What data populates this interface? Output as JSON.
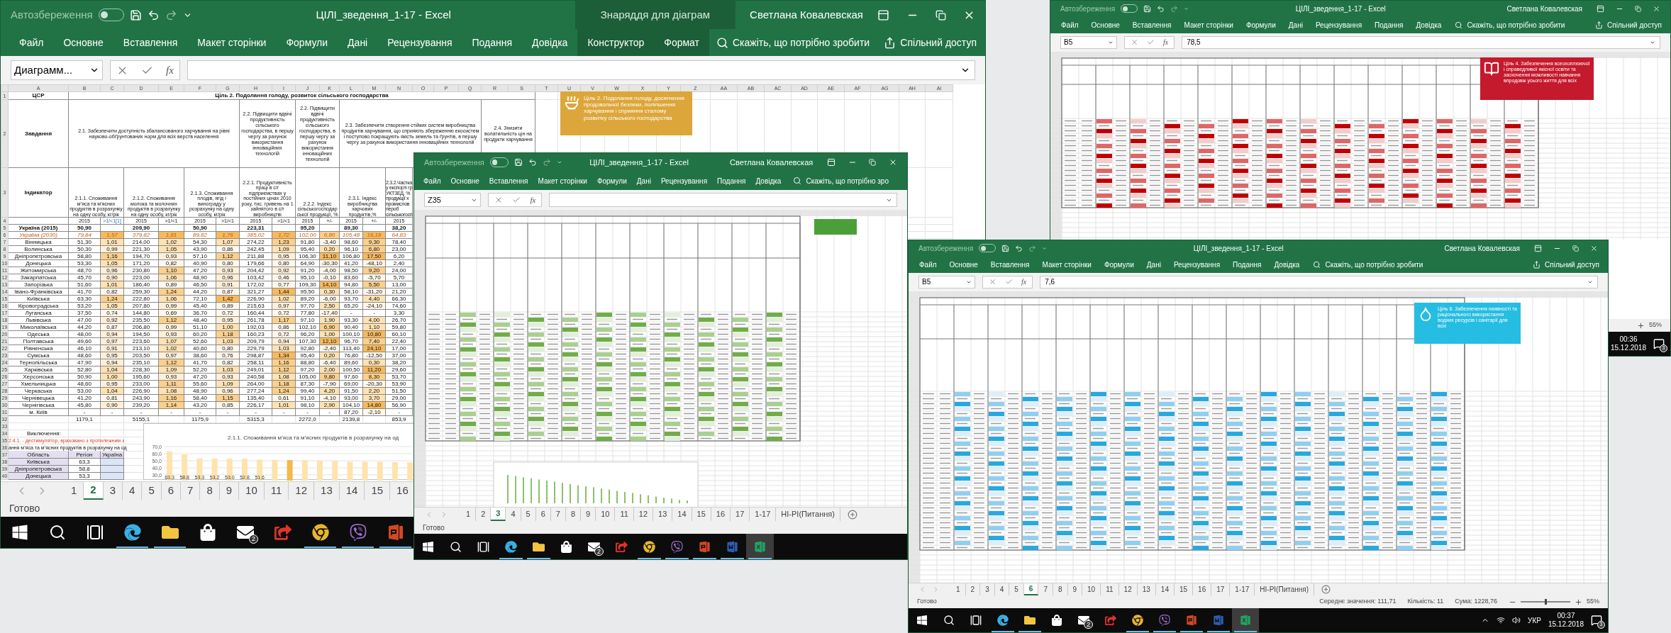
{
  "main_window": {
    "title": "ЦІЛІ_зведення_1-17 - Excel",
    "autosave": {
      "label": "Автозбереження",
      "on": false
    },
    "chart_tools": "Знаряддя для діаграм",
    "user": "Светлана Ковалевская",
    "menu": [
      {
        "label": "Файл",
        "contextual": false
      },
      {
        "label": "Основне",
        "contextual": false
      },
      {
        "label": "Вставлення",
        "contextual": false
      },
      {
        "label": "Макет сторінки",
        "contextual": false
      },
      {
        "label": "Формули",
        "contextual": false
      },
      {
        "label": "Дані",
        "contextual": false
      },
      {
        "label": "Рецензування",
        "contextual": false
      },
      {
        "label": "Подання",
        "contextual": false
      },
      {
        "label": "Довідка",
        "contextual": false
      },
      {
        "label": "Конструктор",
        "contextual": true
      },
      {
        "label": "Формат",
        "contextual": true
      }
    ],
    "search": "Скажіть, що потрібно зробити",
    "share": "Спільний доступ",
    "name_box": "Диаграмм...",
    "function_label": "fx",
    "sheet": {
      "column_headers": [
        "A",
        "B",
        "C",
        "D",
        "E",
        "F",
        "G",
        "H",
        "I",
        "J",
        "K",
        "L",
        "M",
        "N",
        "O",
        "P",
        "Q",
        "R",
        "S",
        "T",
        "U",
        "V",
        "W",
        "X",
        "Y",
        "Z",
        "AA",
        "AB",
        "AC",
        "AD",
        "AE",
        "AF",
        "AG",
        "AH",
        "AI"
      ],
      "row_numbers": [
        "1",
        "2",
        "3",
        "4",
        "5",
        "6",
        "7",
        "8",
        "9",
        "10",
        "11",
        "12",
        "13",
        "14",
        "15",
        "16",
        "17",
        "18",
        "19",
        "20",
        "21",
        "22",
        "23",
        "24",
        "25",
        "26",
        "27",
        "28",
        "29",
        "30",
        "31",
        "32",
        "33",
        "34",
        "35",
        "36",
        "37",
        "38",
        "39",
        "40"
      ],
      "goal_row": {
        "label": "ЦСР",
        "title": "Ціль 2. Подолання голоду, розвиток сільського господарства"
      },
      "tasks": {
        "label": "Завдання",
        "items": [
          "2.1. Забезпечити доступність збалансованого харчування на рівні науково-обґрунтованих норм для всіх верств населення",
          "2.2. Підвищити вдвічі продуктивність сільського господарства, в першу чергу за рахунок використання інноваційних технологій",
          "2.2. Підвищити вдвічі продуктивність сільського господарства, в першу чергу за рахунок використання інноваційних технологій",
          "2.3. Забезпечити створення стійких систем виробництва продуктів харчування, що сприяють збереженню екосистем і поступово покращують якість земель та ґрунтів, в першу чергу за рахунок використання інноваційних технологій",
          "2.4. Знизити волатильність цін на продукти харчування"
        ]
      },
      "indicators": {
        "label": "Індикатор",
        "items": [
          "2.1.1. Споживання м’яса та м’ясних продуктів в розрахунку на одну особу, кг/рік",
          "2.1.2. Споживання молока та молочних продуктів в розрахунку на одну особу, кг/рік",
          "2.1.3. Споживання плодів, ягід і винограду у розрахунку на одну особу, кг/рік",
          "2.2.1. Продуктивність праці в с/г підприємствах у постійних цінах 2010 року, тис. гривень на 1 зайнятого в с/г виробництві",
          "2.2.2. Індекс сільськогосподарської продукції, %",
          "2.3.1. Індекс виробництва харчових продуктів,%",
          "2.3.2.Частка\nу експорті гр\nУКТЗЕД, %\nпродукції х\nпромислов\nпероб\nсільськогосп"
        ]
      },
      "periods": [
        "2015",
        ">1/<1[1]",
        "2015",
        ">1/<1",
        "2015",
        ">1/<1",
        "2015",
        ">1/<1",
        "2015",
        "+/-",
        "2015",
        "+/-",
        "2015"
      ],
      "rows": [
        {
          "kind": "total",
          "region": "Україна (2015)",
          "values": [
            "50,90",
            "209,90",
            "50,90",
            "223,31",
            "95,20",
            "89,30",
            "38,20"
          ]
        },
        {
          "kind": "target",
          "region": "Україна (2030)",
          "values": [
            "79,84",
            "1,57",
            "379,82",
            "1,81",
            "89,82",
            "1,76",
            "385,02",
            "1,72",
            "102,00",
            "6,80",
            "105,48",
            "16,18",
            "64,83"
          ]
        },
        {
          "kind": "region",
          "region": "Вінницька",
          "values": [
            "51,30",
            "1,01",
            "214,00",
            "1,02",
            "54,30",
            "1,07",
            "274,22",
            "1,23",
            "91,80",
            "-3,40",
            "98,60",
            "9,30",
            "78,40"
          ]
        },
        {
          "kind": "region",
          "region": "Волинська",
          "values": [
            "50,30",
            "0,99",
            "221,30",
            "1,05",
            "43,90",
            "0,86",
            "242,45",
            "1,09",
            "95,40",
            "0,20",
            "96,10",
            "6,80",
            "23,00"
          ]
        },
        {
          "kind": "region",
          "region": "Дніпропетровська",
          "values": [
            "58,80",
            "1,16",
            "194,70",
            "0,93",
            "57,10",
            "1,12",
            "211,88",
            "0,95",
            "106,30",
            "11,10",
            "106,80",
            "17,50",
            "6,20"
          ]
        },
        {
          "kind": "region",
          "region": "Донецька",
          "values": [
            "53,30",
            "1,05",
            "171,20",
            "0,82",
            "40,90",
            "0,80",
            "179,66",
            "0,80",
            "64,90",
            "-30,30",
            "41,20",
            "-48,10",
            "2,40"
          ]
        },
        {
          "kind": "region",
          "region": "Житомирська",
          "values": [
            "48,70",
            "0,96",
            "230,80",
            "1,10",
            "47,20",
            "0,93",
            "204,42",
            "0,92",
            "91,20",
            "-4,00",
            "98,50",
            "9,20",
            "24,00"
          ]
        },
        {
          "kind": "region",
          "region": "Закарпатська",
          "values": [
            "45,70",
            "0,90",
            "223,00",
            "1,06",
            "48,90",
            "0,96",
            "103,42",
            "0,46",
            "95,10",
            "-0,10",
            "83,60",
            "-5,70",
            "5,70"
          ]
        },
        {
          "kind": "region",
          "region": "Запорізька",
          "values": [
            "51,60",
            "1,01",
            "186,40",
            "0,89",
            "46,50",
            "0,91",
            "172,02",
            "0,77",
            "109,30",
            "14,10",
            "94,80",
            "5,50",
            "13,00"
          ]
        },
        {
          "kind": "region",
          "region": "Івано-Франківська",
          "values": [
            "41,70",
            "0,82",
            "259,30",
            "1,24",
            "44,20",
            "0,87",
            "321,27",
            "1,44",
            "95,50",
            "0,30",
            "58,10",
            "-31,20",
            "21,20"
          ]
        },
        {
          "kind": "region",
          "region": "Київська",
          "values": [
            "63,30",
            "1,24",
            "222,80",
            "1,06",
            "72,10",
            "1,42",
            "226,90",
            "1,02",
            "89,20",
            "-6,00",
            "93,70",
            "4,40",
            "66,30"
          ]
        },
        {
          "kind": "region",
          "region": "Кіровоградська",
          "values": [
            "53,20",
            "1,05",
            "207,80",
            "0,99",
            "45,40",
            "0,89",
            "215,63",
            "0,97",
            "97,70",
            "2,50",
            "65,20",
            "-24,10",
            "74,60"
          ]
        },
        {
          "kind": "region",
          "region": "Луганська",
          "values": [
            "37,50",
            "0,74",
            "144,80",
            "0,69",
            "36,70",
            "0,72",
            "160,44",
            "0,72",
            "77,80",
            "-17,40",
            "-",
            "-",
            "3,30"
          ]
        },
        {
          "kind": "region",
          "region": "Львівська",
          "values": [
            "47,00",
            "0,92",
            "235,50",
            "1,12",
            "48,40",
            "0,95",
            "261,78",
            "1,17",
            "97,10",
            "1,90",
            "93,30",
            "4,00",
            "26,70"
          ]
        },
        {
          "kind": "region",
          "region": "Миколаївська",
          "values": [
            "44,20",
            "0,87",
            "206,80",
            "0,99",
            "51,10",
            "1,00",
            "192,03",
            "0,86",
            "102,10",
            "6,90",
            "90,40",
            "1,10",
            "59,80"
          ]
        },
        {
          "kind": "region",
          "region": "Одеська",
          "values": [
            "48,00",
            "0,94",
            "194,50",
            "0,93",
            "60,20",
            "1,18",
            "160,23",
            "0,72",
            "96,20",
            "1,00",
            "100,10",
            "10,80",
            "60,10"
          ]
        },
        {
          "kind": "region",
          "region": "Полтавська",
          "values": [
            "49,60",
            "0,97",
            "223,60",
            "1,07",
            "52,60",
            "1,03",
            "209,79",
            "0,94",
            "107,30",
            "12,10",
            "96,70",
            "7,40",
            "22,40"
          ]
        },
        {
          "kind": "region",
          "region": "Рівненська",
          "values": [
            "46,10",
            "0,91",
            "213,10",
            "1,02",
            "40,60",
            "0,80",
            "229,79",
            "1,03",
            "92,80",
            "-2,40",
            "113,40",
            "24,10",
            "17,00"
          ]
        },
        {
          "kind": "region",
          "region": "Сумська",
          "values": [
            "48,60",
            "0,95",
            "203,50",
            "0,97",
            "38,60",
            "0,76",
            "298,87",
            "1,34",
            "95,40",
            "0,20",
            "76,80",
            "-12,50",
            "37,00"
          ]
        },
        {
          "kind": "region",
          "region": "Тернопільська",
          "values": [
            "47,90",
            "0,94",
            "235,10",
            "1,12",
            "41,70",
            "0,82",
            "258,11",
            "1,16",
            "88,80",
            "-6,40",
            "89,60",
            "0,30",
            "38,20"
          ]
        },
        {
          "kind": "region",
          "region": "Харківська",
          "values": [
            "52,80",
            "1,04",
            "228,30",
            "1,09",
            "52,20",
            "1,03",
            "249,01",
            "1,12",
            "97,20",
            "2,00",
            "100,50",
            "11,20",
            "29,60"
          ]
        },
        {
          "kind": "region",
          "region": "Херсонська",
          "values": [
            "50,90",
            "1,00",
            "195,60",
            "0,93",
            "47,20",
            "0,93",
            "240,58",
            "1,08",
            "105,00",
            "9,80",
            "97,60",
            "8,30",
            "53,70"
          ]
        },
        {
          "kind": "region",
          "region": "Хмельницька",
          "values": [
            "48,60",
            "0,95",
            "233,00",
            "1,11",
            "55,60",
            "1,09",
            "264,00",
            "1,18",
            "87,30",
            "-7,90",
            "69,00",
            "-20,30",
            "53,90"
          ]
        },
        {
          "kind": "region",
          "region": "Черкаська",
          "values": [
            "53,00",
            "1,04",
            "226,90",
            "1,08",
            "48,90",
            "0,96",
            "277,24",
            "1,24",
            "99,40",
            "4,20",
            "91,50",
            "2,20",
            "51,50"
          ]
        },
        {
          "kind": "region",
          "region": "Чернівецька",
          "values": [
            "41,20",
            "0,81",
            "243,90",
            "1,16",
            "58,40",
            "1,15",
            "135,40",
            "0,61",
            "91,10",
            "-4,10",
            "93,00",
            "3,70",
            "29,00"
          ]
        },
        {
          "kind": "region",
          "region": "Чернігівська",
          "values": [
            "45,80",
            "0,90",
            "239,20",
            "1,14",
            "43,20",
            "0,85",
            "226,17",
            "1,01",
            "98,10",
            "2,90",
            "104,10",
            "14,80",
            "56,90"
          ]
        },
        {
          "kind": "region",
          "region": "м. Київ",
          "values": [
            "-",
            "-",
            "-",
            "-",
            "-",
            "-",
            "-",
            "-",
            "-",
            "-",
            "87,20",
            "-2,10",
            "-"
          ]
        }
      ],
      "totals": [
        "1179,1",
        "5155,1",
        "1175,9",
        "5315,3",
        "2272,0",
        "2139,8",
        "853,9"
      ],
      "notes": {
        "heading": "Виключення:",
        "lines": [
          "2.4.1. - дестимулятор, враховано з протилежним з",
          "ання м’яса та м’ясних продуктів в розрахунку на од"
        ]
      },
      "mini_table": {
        "columns": [
          "Область",
          "Регіон",
          "Україна"
        ],
        "rows": [
          [
            "Київська",
            "63,3"
          ],
          [
            "Дніпропетровська",
            "58,8"
          ],
          [
            "Донецька",
            "53,3"
          ]
        ]
      },
      "goal_card": "Ціль 2. Подолання голоду, досягнення продовольчої безпеки, поліпшення харчування і сприяння сталому розвитку сільського господарства",
      "chart_data": {
        "type": "bar",
        "title": "2.1.1.  Споживання м’яса та м’ясних продуктів в розрахунку на од",
        "grid": true,
        "ylim": [
          30,
          70
        ],
        "yticks": [
          {
            "value": 70,
            "label": "70,0"
          },
          {
            "value": 60,
            "label": "60,0"
          },
          {
            "value": 50,
            "label": "50,0"
          },
          {
            "value": 40,
            "label": "40,0"
          },
          {
            "value": 30,
            "label": "30,0"
          }
        ],
        "stacked": true,
        "series": [
          {
            "color": "#ffe3ad",
            "values": [
              63.3,
              58.8,
              53.3,
              53.2,
              53.0,
              52.8,
              51.6,
              51.3,
              null,
              50.9,
              50.3,
              49.6,
              48.7,
              48.6,
              48.6,
              48.0,
              47.9
            ]
          },
          {
            "color": "#f3b94d",
            "values": [
              null,
              null,
              null,
              null,
              null,
              null,
              null,
              null,
              50.9,
              null,
              null,
              null,
              null,
              null,
              null,
              null,
              null
            ]
          }
        ],
        "value_labels": [
          "63,3",
          "58,8",
          "53,3",
          "53,2",
          "53,0",
          "52,8",
          "51,6"
        ]
      }
    },
    "sheet_tabs": [
      {
        "label": "1",
        "selected": false
      },
      {
        "label": "2",
        "selected": true
      },
      {
        "label": "3",
        "selected": false
      },
      {
        "label": "4",
        "selected": false
      },
      {
        "label": "5",
        "selected": false
      },
      {
        "label": "6",
        "selected": false
      },
      {
        "label": "7",
        "selected": false
      },
      {
        "label": "8",
        "selected": false
      },
      {
        "label": "9",
        "selected": false
      },
      {
        "label": "10",
        "selected": false
      },
      {
        "label": "11",
        "selected": false
      },
      {
        "label": "12",
        "selected": false
      },
      {
        "label": "13",
        "selected": false
      },
      {
        "label": "14",
        "selected": false
      },
      {
        "label": "15",
        "selected": false
      },
      {
        "label": "16",
        "selected": false
      }
    ],
    "status": {
      "ready": "Готово"
    },
    "taskbar": {
      "apps": [
        {
          "kind": "start",
          "running": false
        },
        {
          "kind": "search",
          "running": false
        },
        {
          "kind": "task_view",
          "running": false
        },
        {
          "kind": "edge",
          "running": true
        },
        {
          "kind": "explorer",
          "running": true
        },
        {
          "kind": "store",
          "running": false
        },
        {
          "kind": "mail",
          "running": false,
          "badge": "2"
        },
        {
          "kind": "pdf",
          "running": false
        },
        {
          "kind": "chrome",
          "running": true
        },
        {
          "kind": "viber",
          "running": true
        },
        {
          "kind": "powerpoint",
          "running": true
        }
      ]
    }
  },
  "top_right_window": {
    "title": "ЦІЛІ_зведення_1-17 - Excel",
    "autosave": {
      "label": "Автозбереження",
      "on": false
    },
    "user": "Светлана Ковалевская",
    "menu": [
      {
        "label": "Файл",
        "contextual": false
      },
      {
        "label": "Основне",
        "contextual": false
      },
      {
        "label": "Вставлення",
        "contextual": false
      },
      {
        "label": "Макет сторінки",
        "contextual": false
      },
      {
        "label": "Формули",
        "contextual": false
      },
      {
        "label": "Дані",
        "contextual": false
      },
      {
        "label": "Рецензування",
        "contextual": false
      },
      {
        "label": "Подання",
        "contextual": false
      },
      {
        "label": "Довідка",
        "contextual": false
      }
    ],
    "search": "Скажіть, що потрібно зробити",
    "share": "Спільний доступ",
    "name_box": "B5",
    "function_label": "fx",
    "formula": "78,5",
    "goal_card": "Ціль 4. Забезпечення всеохоплюючої і справедливої якісної освіти та заохочення можливості навчання впродовж усього життя для всіх",
    "status": {
      "zoom": "55%"
    },
    "taskbar": {
      "tray": {
        "time": "00:36",
        "date": "15.12.2018",
        "notifications": "3"
      }
    }
  },
  "center_window": {
    "title": "ЦІЛІ_зведення_1-17 - Excel",
    "autosave": {
      "label": "Автозбереження",
      "on": false
    },
    "user": "Светлана Ковалевская",
    "menu": [
      {
        "label": "Файл",
        "contextual": false
      },
      {
        "label": "Основне",
        "contextual": false
      },
      {
        "label": "Вставлення",
        "contextual": false
      },
      {
        "label": "Макет сторінки",
        "contextual": false
      },
      {
        "label": "Формули",
        "contextual": false
      },
      {
        "label": "Дані",
        "contextual": false
      },
      {
        "label": "Рецензування",
        "contextual": false
      },
      {
        "label": "Подання",
        "contextual": false
      },
      {
        "label": "Довідка",
        "contextual": false
      }
    ],
    "search": "Скажіть, що потрібно зро",
    "name_box": "Z35",
    "function_label": "fx",
    "sheet_tabs": [
      {
        "label": "1",
        "selected": false
      },
      {
        "label": "2",
        "selected": false
      },
      {
        "label": "3",
        "selected": true
      },
      {
        "label": "4",
        "selected": false
      },
      {
        "label": "5",
        "selected": false
      },
      {
        "label": "6",
        "selected": false
      },
      {
        "label": "7",
        "selected": false
      },
      {
        "label": "8",
        "selected": false
      },
      {
        "label": "9",
        "selected": false
      },
      {
        "label": "10",
        "selected": false
      },
      {
        "label": "11",
        "selected": false
      },
      {
        "label": "12",
        "selected": false
      },
      {
        "label": "13",
        "selected": false
      },
      {
        "label": "14",
        "selected": false
      },
      {
        "label": "15",
        "selected": false
      },
      {
        "label": "16",
        "selected": false
      },
      {
        "label": "17",
        "selected": false
      },
      {
        "label": "1-17",
        "selected": false
      },
      {
        "label": "НІ-РІ(Питання)",
        "selected": false
      }
    ],
    "status": {
      "ready": "Готово"
    },
    "taskbar": {
      "apps": [
        {
          "kind": "start",
          "running": false
        },
        {
          "kind": "search",
          "running": false
        },
        {
          "kind": "task_view",
          "running": false
        },
        {
          "kind": "edge",
          "running": true
        },
        {
          "kind": "explorer",
          "running": true
        },
        {
          "kind": "store",
          "running": false
        },
        {
          "kind": "mail",
          "running": false,
          "badge": "2"
        },
        {
          "kind": "pdf",
          "running": false
        },
        {
          "kind": "chrome",
          "running": true
        },
        {
          "kind": "viber",
          "running": true
        },
        {
          "kind": "powerpoint",
          "running": true
        },
        {
          "kind": "word",
          "running": true
        },
        {
          "kind": "excel",
          "running": true,
          "active": true
        }
      ]
    }
  },
  "bottom_right_window": {
    "title": "ЦІЛІ_зведення_1-17 - Excel",
    "autosave": {
      "label": "Автозбереження",
      "on": false
    },
    "user": "Светлана Ковалевская",
    "menu": [
      {
        "label": "Файл",
        "contextual": false
      },
      {
        "label": "Основне",
        "contextual": false
      },
      {
        "label": "Вставлення",
        "contextual": false
      },
      {
        "label": "Макет сторінки",
        "contextual": false
      },
      {
        "label": "Формули",
        "contextual": false
      },
      {
        "label": "Дані",
        "contextual": false
      },
      {
        "label": "Рецензування",
        "contextual": false
      },
      {
        "label": "Подання",
        "contextual": false
      },
      {
        "label": "Довідка",
        "contextual": false
      }
    ],
    "search": "Скажіть, що потрібно зробити",
    "share": "Спільний доступ",
    "name_box": "B5",
    "function_label": "fx",
    "formula": "7,6",
    "goal_card": "Ціль 6. Забезпечення наявності та раціонального використання водних ресурсів і санітарії для всіх",
    "sheet_tabs": [
      {
        "label": "1",
        "selected": false
      },
      {
        "label": "2",
        "selected": false
      },
      {
        "label": "3",
        "selected": false
      },
      {
        "label": "4",
        "selected": false
      },
      {
        "label": "5",
        "selected": false
      },
      {
        "label": "6",
        "selected": true
      },
      {
        "label": "7",
        "selected": false
      },
      {
        "label": "8",
        "selected": false
      },
      {
        "label": "9",
        "selected": false
      },
      {
        "label": "10",
        "selected": false
      },
      {
        "label": "11",
        "selected": false
      },
      {
        "label": "12",
        "selected": false
      },
      {
        "label": "13",
        "selected": false
      },
      {
        "label": "14",
        "selected": false
      },
      {
        "label": "15",
        "selected": false
      },
      {
        "label": "16",
        "selected": false
      },
      {
        "label": "17",
        "selected": false
      },
      {
        "label": "1-17",
        "selected": false
      },
      {
        "label": "НІ-РІ(Питання)",
        "selected": false
      }
    ],
    "status": {
      "ready": "Готово",
      "stats": [
        "Середнє значення: 111,71",
        "Кількість: 11",
        "Сума: 1228,76"
      ],
      "zoom_slider": {
        "level": 0.5
      },
      "zoom": "55%"
    },
    "taskbar": {
      "apps": [
        {
          "kind": "start",
          "running": false
        },
        {
          "kind": "search",
          "running": false
        },
        {
          "kind": "task_view",
          "running": false
        },
        {
          "kind": "edge",
          "running": true
        },
        {
          "kind": "explorer",
          "running": true
        },
        {
          "kind": "store",
          "running": false
        },
        {
          "kind": "mail",
          "running": false,
          "badge": "2"
        },
        {
          "kind": "pdf",
          "running": false
        },
        {
          "kind": "chrome",
          "running": true
        },
        {
          "kind": "viber",
          "running": true
        },
        {
          "kind": "powerpoint",
          "running": true
        },
        {
          "kind": "word",
          "running": true
        },
        {
          "kind": "excel",
          "running": true,
          "active": true
        }
      ],
      "tray": {
        "language": "УКР",
        "time": "00:37",
        "date": "15.12.2018",
        "notifications": "3"
      }
    }
  }
}
